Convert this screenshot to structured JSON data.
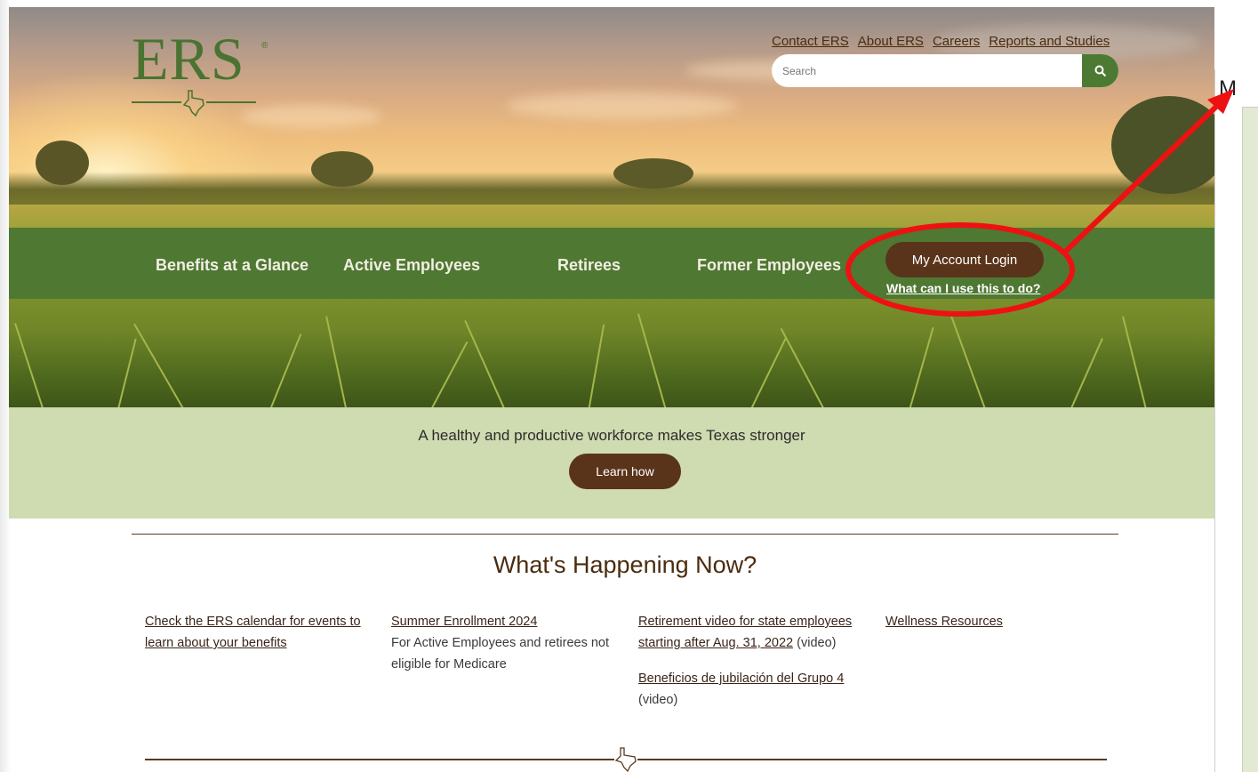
{
  "header": {
    "logo_text": "ERS",
    "logo_reg": "®",
    "top_links": [
      {
        "label": "Contact ERS"
      },
      {
        "label": "About ERS"
      },
      {
        "label": "Careers"
      },
      {
        "label": "Reports and Studies"
      }
    ],
    "search": {
      "placeholder": "Search"
    }
  },
  "nav": {
    "items": [
      {
        "label": "Benefits at a Glance"
      },
      {
        "label": "Active Employees"
      },
      {
        "label": "Retirees"
      },
      {
        "label": "Former Employees"
      }
    ],
    "login_label": "My Account Login",
    "login_help": "What can I use this to do?"
  },
  "tagline": {
    "text": "A healthy and productive workforce makes Texas stronger",
    "button": "Learn how"
  },
  "whats_happening": {
    "title": "What's Happening Now?",
    "col1_link": "Check the ERS calendar for events to learn about your benefits",
    "col2_link": "Summer Enrollment 2024",
    "col2_text": "For Active Employees and retirees not eligible for Medicare",
    "col3_link1": "Retirement video for state employees starting after Aug. 31, 2022",
    "col3_suffix1": " (video)",
    "col3_link2": "Beneficios de jubilación del Grupo 4",
    "col3_suffix2": " (video)",
    "col4_link": "Wellness Resources"
  },
  "side_panel": {
    "letter": "M"
  },
  "colors": {
    "brand_green": "#4f7832",
    "brown_button": "#5a341a",
    "tagline_bg": "#cfdbb0",
    "annotation_red": "#ee1111"
  }
}
